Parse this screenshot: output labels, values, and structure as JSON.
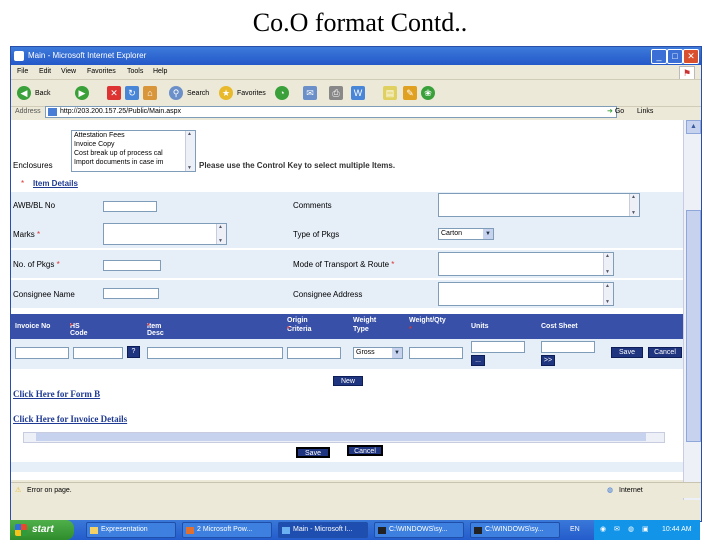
{
  "slide": {
    "title": "Co.O format Contd.."
  },
  "browser": {
    "title": "Main - Microsoft Internet Explorer",
    "menu": [
      "File",
      "Edit",
      "View",
      "Favorites",
      "Tools",
      "Help"
    ],
    "toolbar": {
      "back": "Back",
      "search": "Search",
      "favorites": "Favorites"
    },
    "address_label": "Address",
    "url": "http://203.200.157.25/Public/Main.aspx",
    "go": "Go",
    "links": "Links",
    "status": "Error on page.",
    "zone": "Internet"
  },
  "form": {
    "list_options": [
      "Attestation Fees",
      "Invoice Copy",
      "Cost break up of process cal",
      "Import documents in case im"
    ],
    "enclosures_label": "Enclosures",
    "enclosures_hint": "Please use the Control Key to select multiple Items.",
    "section_title": "Item Details",
    "awb_label": "AWB/BL No",
    "comments_label": "Comments",
    "marks_label": "Marks",
    "type_pkgs_label": "Type of Pkgs",
    "type_pkgs_value": "Carton",
    "no_pkgs_label": "No. of Pkgs",
    "transport_label": "Mode of Transport & Route",
    "consignee_label": "Consignee Name",
    "consignee_addr_label": "Consignee Address",
    "required_mark": "*"
  },
  "grid": {
    "headers": {
      "invoice_no": "Invoice No",
      "hs_code": "HS Code",
      "item_desc": "Item Desc",
      "origin_1": "Origin",
      "origin_2": "Criteria",
      "weight_1": "Weight",
      "weight_2": "Type",
      "qty": "Weight/Qty",
      "units": "Units",
      "cost_sheet": "Cost Sheet"
    },
    "weight_type_value": "Gross",
    "help_btn": "?",
    "units_btn": "...",
    "cost_btn": ">>",
    "save_btn": "Save",
    "cancel_btn": "Cancel",
    "new_btn": "New"
  },
  "links": {
    "form_b": "Click Here for Form B",
    "invoice_details": "Click Here for Invoice Details"
  },
  "actions": {
    "save": "Save",
    "cancel": "Cancel"
  },
  "taskbar": {
    "start": "start",
    "tasks": [
      "Expresentation",
      "2 Microsoft Pow...",
      "Main - Microsoft I...",
      "C:\\WINDOWS\\sy...",
      "C:\\WINDOWS\\sy..."
    ],
    "lang": "EN",
    "time": "10:44 AM"
  },
  "colors": {
    "header_blue": "#3850a8",
    "row_bg": "#e6eef8",
    "link": "#1f3a93",
    "required": "#dd3333"
  }
}
